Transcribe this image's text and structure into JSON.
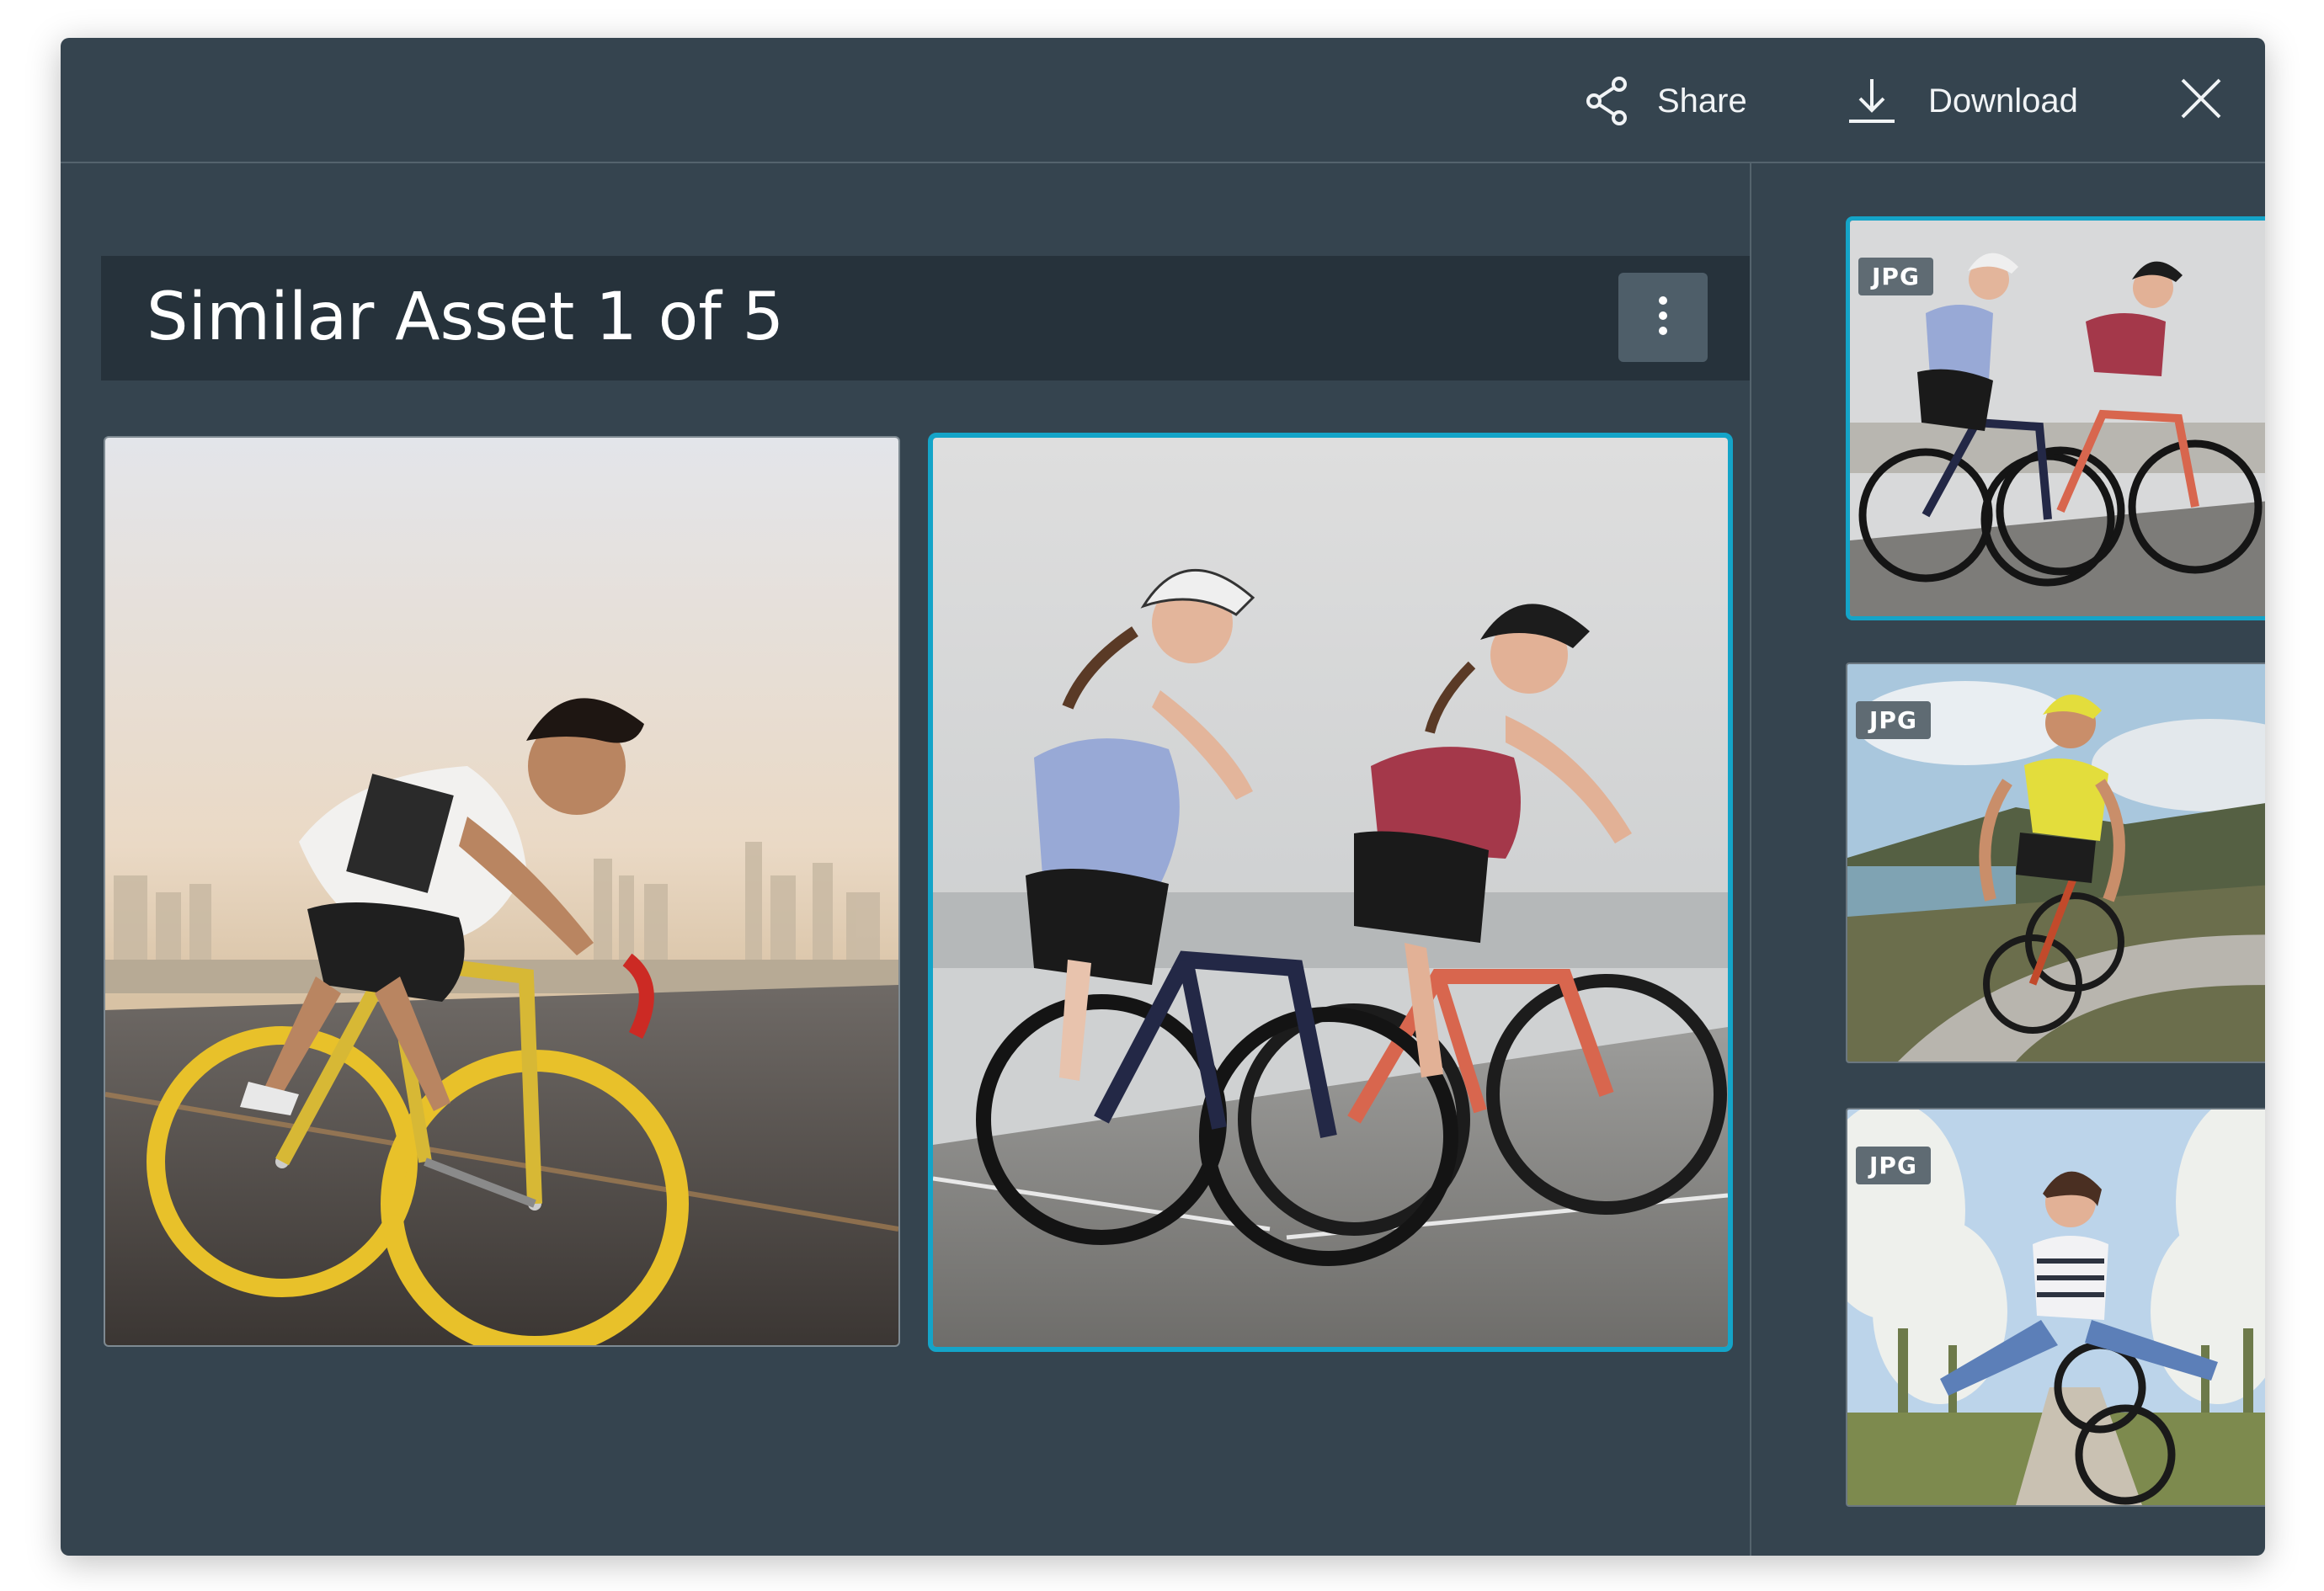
{
  "toolbar": {
    "share_label": "Share",
    "download_label": "Download",
    "share_icon": "share-icon",
    "download_icon": "download-icon",
    "close_icon": "close-icon"
  },
  "title_bar": {
    "title": "Similar Asset 1 of 5",
    "menu_icon": "more-vertical-icon"
  },
  "gallery": [
    {
      "name": "cyclist-yellow-fixie",
      "selected": false
    },
    {
      "name": "two-women-road-bikes",
      "selected": true
    }
  ],
  "thumbnails": [
    {
      "badge": "JPG",
      "name": "two-women-road-bikes",
      "selected": true
    },
    {
      "badge": "JPG",
      "name": "cyclist-yellow-jersey-coast",
      "selected": false
    },
    {
      "badge": "JPG",
      "name": "woman-bike-blossom-trees",
      "selected": false
    }
  ],
  "colors": {
    "modal_bg": "#35444f",
    "title_bar_bg": "#26323b",
    "accent": "#14a4c8",
    "badge_bg": "#5f6b73"
  }
}
